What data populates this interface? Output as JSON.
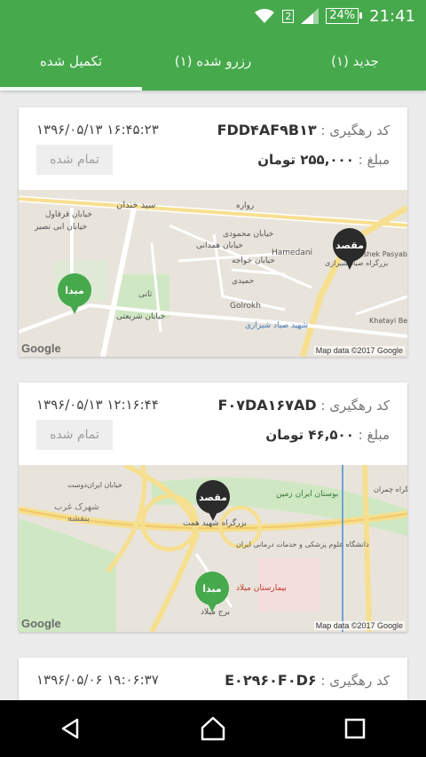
{
  "status": {
    "sim_badge": "2",
    "battery": "24%",
    "time": "21:41"
  },
  "tabs": [
    {
      "label": "جدید (۱)",
      "active": false
    },
    {
      "label": "رزرو شده (۱)",
      "active": false
    },
    {
      "label": "تکمیل شده",
      "active": true
    }
  ],
  "orders": [
    {
      "track_label": "کد رهگیری :",
      "track_code": "FDD۴AF۹B۱۳",
      "datetime": "۱۳۹۶/۰۵/۱۳ ۱۶:۴۵:۲۳",
      "amount_label": "مبلغ :",
      "amount": "۲۵۵,۰۰۰ تومان",
      "status": "تمام شده",
      "map": {
        "origin_label": "مبدا",
        "dest_label": "مقصد",
        "streets": [
          "سید خندان",
          "رواره",
          "خیابان قرقاول",
          "خیابان ابی نصیر",
          "خیابان محمودی",
          "خیابان همدانی",
          "خیابان خواجه",
          "Hamedani",
          "حمیدی",
          "Golrokh",
          "بزرگراه صیاد شیرازی",
          "Bashek Pasyab",
          "Khatayi Bergi",
          "شهید صیاد شیرازی",
          "خیابان شریعتی",
          "ثانی"
        ],
        "google": "Google",
        "map_data": "Map data ©2017 Google"
      }
    },
    {
      "track_label": "کد رهگیری :",
      "track_code": "F۰۷DA۱۶۷AD",
      "datetime": "۱۳۹۶/۰۵/۱۳ ۱۲:۱۶:۴۴",
      "amount_label": "مبلغ :",
      "amount": "۴۶,۵۰۰ تومان",
      "status": "تمام شده",
      "map": {
        "origin_label": "مبدا",
        "dest_label": "مقصد",
        "streets": [
          "بوستان ایران زمین",
          "بزرگراه شهید همت",
          "شهرک غرب",
          "بنفشه",
          "دانشگاه علوم پزشکی و خدمات درمانی ایران",
          "بیمارستان میلاد",
          "برج میلاد",
          "بزرگراه چمران",
          "خیابان ایران‌دوست"
        ],
        "google": "Google",
        "map_data": "Map data ©2017 Google"
      }
    },
    {
      "track_label": "کد رهگیری :",
      "track_code": "E۰۲۹۶۰F۰D۶",
      "datetime": "۱۳۹۶/۰۵/۰۶ ۱۹:۰۶:۳۷"
    }
  ]
}
